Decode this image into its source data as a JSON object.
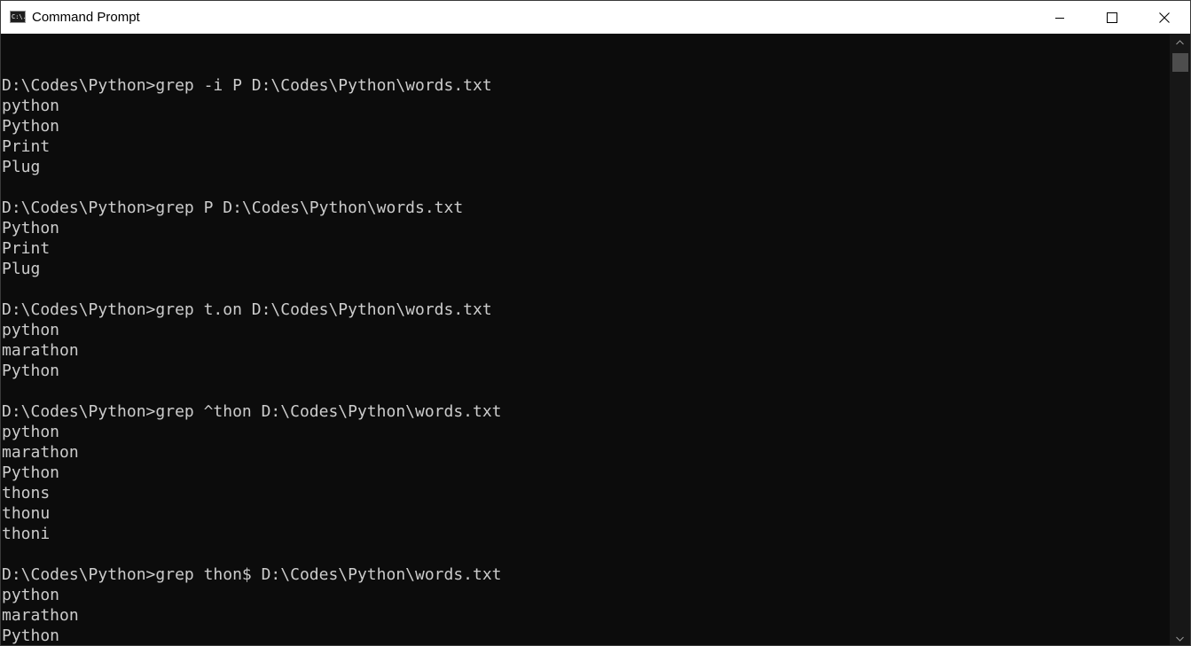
{
  "window": {
    "title": "Command Prompt",
    "app_icon_text": "C:\\.",
    "buttons": {
      "minimize": "minimize-icon",
      "maximize": "maximize-icon",
      "close": "close-icon"
    }
  },
  "console": {
    "lines": [
      "",
      "D:\\Codes\\Python>grep -i P D:\\Codes\\Python\\words.txt",
      "python",
      "Python",
      "Print",
      "Plug",
      "",
      "D:\\Codes\\Python>grep P D:\\Codes\\Python\\words.txt",
      "Python",
      "Print",
      "Plug",
      "",
      "D:\\Codes\\Python>grep t.on D:\\Codes\\Python\\words.txt",
      "python",
      "marathon",
      "Python",
      "",
      "D:\\Codes\\Python>grep ^thon D:\\Codes\\Python\\words.txt",
      "python",
      "marathon",
      "Python",
      "thons",
      "thonu",
      "thoni",
      "",
      "D:\\Codes\\Python>grep thon$ D:\\Codes\\Python\\words.txt",
      "python",
      "marathon",
      "Python"
    ]
  },
  "colors": {
    "background": "#0c0c0c",
    "text": "#cccccc",
    "titlebar": "#ffffff"
  }
}
